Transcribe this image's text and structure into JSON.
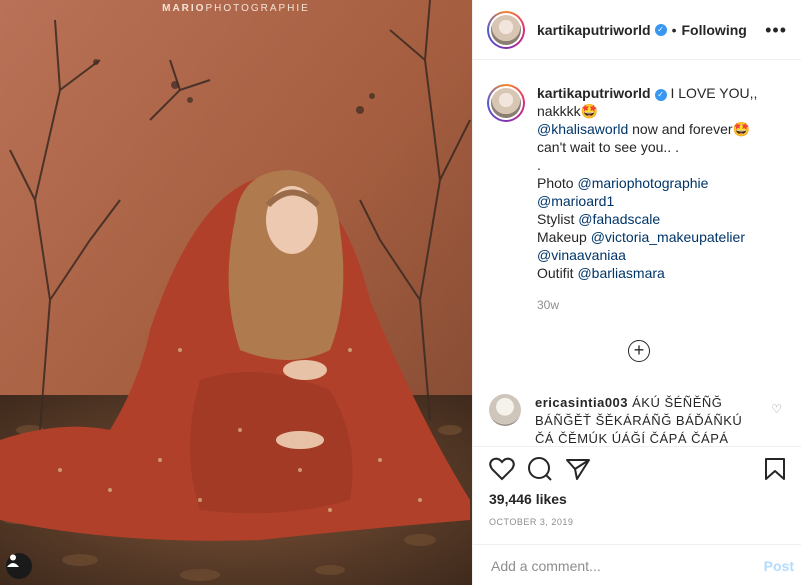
{
  "photo": {
    "watermark_bold": "MARIO",
    "watermark_light": "PHOTOGRAPHIE"
  },
  "header": {
    "username": "kartikaputriworld",
    "dot": "•",
    "following": "Following",
    "more_icon": "more-horizontal-icon"
  },
  "caption": {
    "username": "kartikaputriworld",
    "line1": "I LOVE YOU,,",
    "line2": "nakkkk🤩",
    "mention1": "@khalisaworld",
    "line3": " now and forever🤩",
    "line4": "can't wait to see you.. .",
    "line5": ".",
    "photo_label": "Photo ",
    "photo_mention": "@mariophotographie",
    "mention2": "@marioard1",
    "stylist_label": "Stylist ",
    "stylist_mention": "@fahadscale",
    "makeup_label": "Makeup ",
    "makeup_mention": "@victoria_makeupatelier",
    "mention3": "@vinaavaniaa",
    "outfit_label": "Outifit ",
    "outfit_mention": "@barliasmara",
    "time": "30w"
  },
  "load_more_icon": "plus-circle-icon",
  "comment": {
    "username": "ericasintia003",
    "text": " ÁKÚ ŠÉÑĚÑĞ BÁÑĞĚŤ ŠĚKÁRÁÑĞ BÁĎÁÑKÚ ČÁ ČĚMÚK ÚÁĞÍ ČÁPÁ ČÁPÁ"
  },
  "actions": {
    "likes": "39,446 likes",
    "date": "OCTOBER 3, 2019"
  },
  "add_comment": {
    "placeholder": "Add a comment...",
    "post_label": "Post"
  }
}
